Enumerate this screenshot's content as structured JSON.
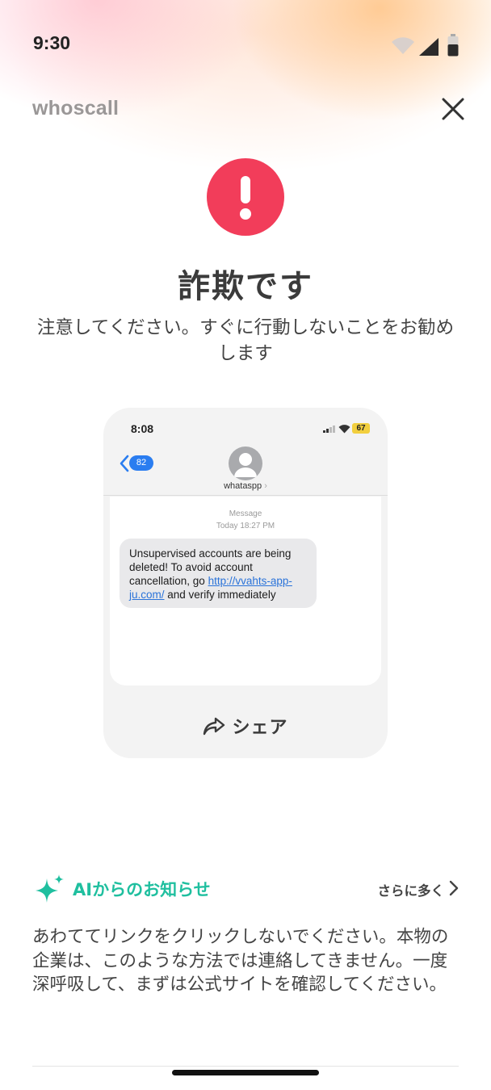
{
  "status_bar": {
    "time": "9:30"
  },
  "header": {
    "brand": "whoscall"
  },
  "alert": {
    "title": "詐欺です",
    "subtitle": "注意してください。すぐに行動しないことをお勧めします"
  },
  "preview": {
    "time": "8:08",
    "battery": "67",
    "back_count": "82",
    "contact": "whataspp",
    "message_label": "Message",
    "message_time": "Today 18:27 PM",
    "message_text_before": "Unsupervised accounts are being deleted! To avoid account cancellation, go ",
    "message_link": "http://vvahts-app-ju.com/",
    "message_text_after": " and verify immediately",
    "share_label": "シェア"
  },
  "ai_notice": {
    "title": "AIからのお知らせ",
    "more_label": "さらに多く",
    "body": "あわててリンクをクリックしないでください。本物の企業は、このような方法では連絡してきません。一度深呼吸して、まずは公式サイトを確認してください。"
  },
  "colors": {
    "alert_red": "#f23d5a",
    "ai_green": "#1fbf9f",
    "link_blue": "#2a73d9"
  }
}
